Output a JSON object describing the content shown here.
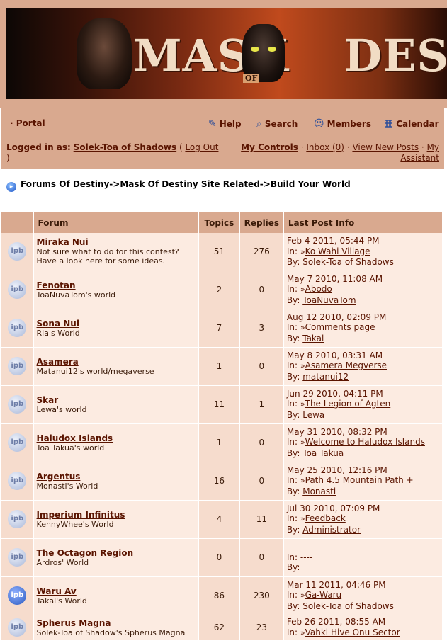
{
  "banner": {
    "title_part1": "MASK",
    "title_of": "OF",
    "title_part2": "DESTINY"
  },
  "nav": {
    "portal": "· Portal",
    "help": "Help",
    "search": "Search",
    "members": "Members",
    "calendar": "Calendar",
    "logged_prefix": "Logged in as:",
    "username": "Solek-Toa of Shadows",
    "logout": "Log Out",
    "my_controls": "My Controls",
    "inbox": "Inbox (0)",
    "view_new_posts": "View New Posts",
    "my_assistant": "My Assistant"
  },
  "breadcrumb": [
    "Forums Of Destiny",
    "Mask Of Destiny Site Related",
    "Build Your World"
  ],
  "table": {
    "headers": {
      "forum": "Forum",
      "topics": "Topics",
      "replies": "Replies",
      "last": "Last Post Info"
    },
    "in_label": "In:",
    "by_label": "By:",
    "rows": [
      {
        "name": "Miraka Nui",
        "desc": "Not sure what to do for this contest? Have a look here for some ideas.",
        "topics": "51",
        "replies": "276",
        "date": "Feb 4 2011, 05:44 PM",
        "in": "Ko Wahi Village",
        "by": "Solek-Toa of Shadows",
        "new": false
      },
      {
        "name": "Fenotan",
        "desc": "ToaNuvaTom's world",
        "topics": "2",
        "replies": "0",
        "date": "May 7 2010, 11:08 AM",
        "in": "Abodo",
        "by": "ToaNuvaTom",
        "new": false
      },
      {
        "name": "Sona Nui",
        "desc": "Ria's World",
        "topics": "7",
        "replies": "3",
        "date": "Aug 12 2010, 02:09 PM",
        "in": "Comments page",
        "by": "Takal",
        "new": false
      },
      {
        "name": "Asamera",
        "desc": "Matanui12's world/megaverse",
        "topics": "1",
        "replies": "0",
        "date": "May 8 2010, 03:31 AM",
        "in": "Asamera Megverse",
        "by": "matanui12",
        "new": false
      },
      {
        "name": "Skar",
        "desc": "Lewa's world",
        "topics": "11",
        "replies": "1",
        "date": "Jun 29 2010, 04:11 PM",
        "in": "The Legion of Agten",
        "by": "Lewa",
        "new": false
      },
      {
        "name": "Haludox Islands",
        "desc": "Toa Takua's world",
        "topics": "1",
        "replies": "0",
        "date": "May 31 2010, 08:32 PM",
        "in": "Welcome to Haludox Islands",
        "by": "Toa Takua",
        "new": false
      },
      {
        "name": "Argentus",
        "desc": "Monasti's World",
        "topics": "16",
        "replies": "0",
        "date": "May 25 2010, 12:16 PM",
        "in": "Path 4.5 Mountain Path +",
        "by": "Monasti",
        "new": false
      },
      {
        "name": "Imperium Infinitus",
        "desc": "KennyWhee's World",
        "topics": "4",
        "replies": "11",
        "date": "Jul 30 2010, 07:09 PM",
        "in": "Feedback",
        "by": "Administrator",
        "new": false
      },
      {
        "name": "The Octagon Region",
        "desc": "Ardros' World",
        "topics": "0",
        "replies": "0",
        "date": "--",
        "in": "----",
        "by": "",
        "new": false
      },
      {
        "name": "Waru Av",
        "desc": "Takal's World",
        "topics": "86",
        "replies": "230",
        "date": "Mar 11 2011, 04:46 PM",
        "in": "Ga-Waru",
        "by": "Solek-Toa of Shadows",
        "new": true
      },
      {
        "name": "Spherus Magna",
        "desc": "Solek-Toa of Shadow's Spherus Magna",
        "topics": "62",
        "replies": "23",
        "date": "Feb 26 2011, 08:55 AM",
        "in": "Vahki Hive Onu Sector",
        "by": "",
        "new": false
      }
    ]
  }
}
